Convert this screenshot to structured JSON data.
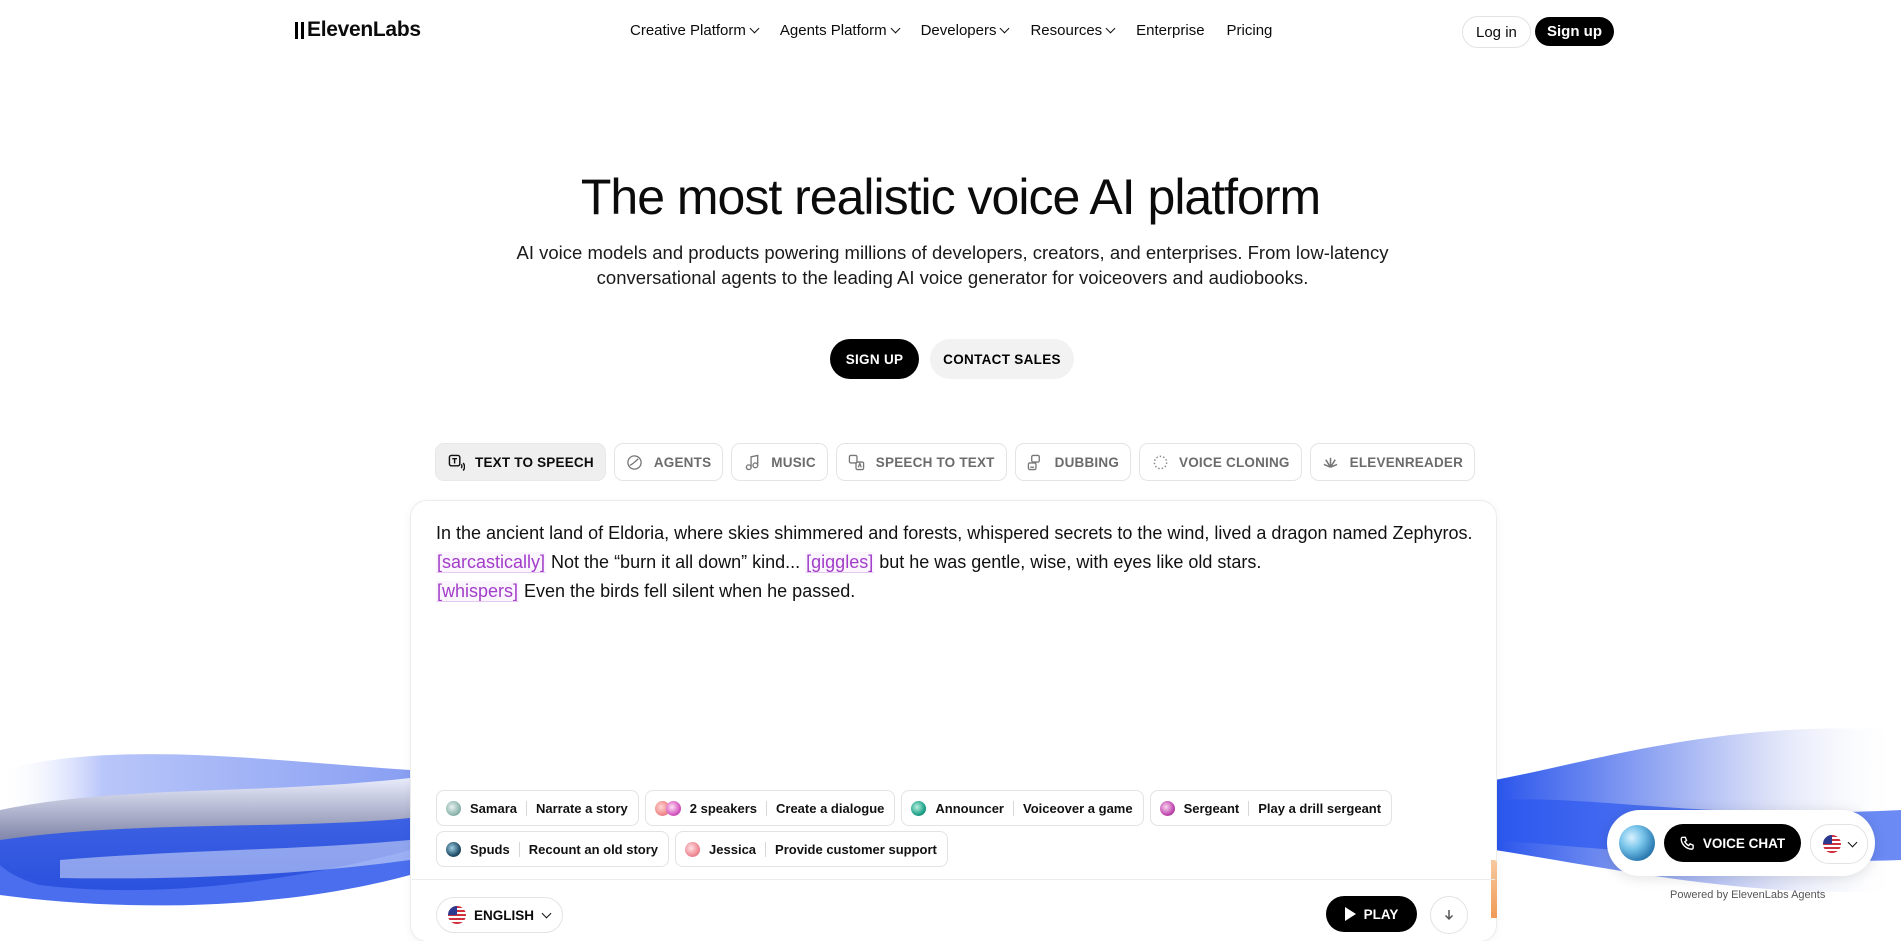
{
  "brand": {
    "logo_text": "ElevenLabs"
  },
  "nav": {
    "items": [
      {
        "label": "Creative Platform",
        "dropdown": true
      },
      {
        "label": "Agents Platform",
        "dropdown": true
      },
      {
        "label": "Developers",
        "dropdown": true
      },
      {
        "label": "Resources",
        "dropdown": true
      },
      {
        "label": "Enterprise",
        "dropdown": false
      },
      {
        "label": "Pricing",
        "dropdown": false
      }
    ],
    "login_label": "Log in",
    "signup_label": "Sign up"
  },
  "hero": {
    "title": "The most realistic voice AI platform",
    "subtitle": "AI voice models and products powering millions of developers, creators, and enterprises. From low-latency conversational agents to the leading AI voice generator for voiceovers and audiobooks.",
    "cta_primary": "SIGN UP",
    "cta_secondary": "CONTACT SALES"
  },
  "tabs": [
    {
      "label": "TEXT TO SPEECH",
      "icon": "text-to-speech-icon",
      "active": true
    },
    {
      "label": "AGENTS",
      "icon": "agents-icon",
      "active": false
    },
    {
      "label": "MUSIC",
      "icon": "music-icon",
      "active": false
    },
    {
      "label": "SPEECH TO TEXT",
      "icon": "speech-to-text-icon",
      "active": false
    },
    {
      "label": "DUBBING",
      "icon": "dubbing-icon",
      "active": false
    },
    {
      "label": "VOICE CLONING",
      "icon": "voice-cloning-icon",
      "active": false
    },
    {
      "label": "ELEVENREADER",
      "icon": "elevenreader-icon",
      "active": false
    }
  ],
  "editor": {
    "segments": [
      {
        "text": "In the ancient land of Eldoria, where skies shimmered and forests, whispered secrets to the wind, lived a dragon named Zephyros. ",
        "tag": false
      },
      {
        "text": "[sarcastically]",
        "tag": true
      },
      {
        "text": " Not the “burn it all down” kind... ",
        "tag": false
      },
      {
        "text": "[giggles]",
        "tag": true
      },
      {
        "text": " but he was gentle, wise, with eyes like old stars. ",
        "tag": false
      },
      {
        "text": "[whispers]",
        "tag": true
      },
      {
        "text": " Even the birds fell silent when he passed.",
        "tag": false
      }
    ],
    "presets": [
      [
        {
          "name": "Samara",
          "task": "Narrate a story",
          "color": "#8fb7b0"
        },
        {
          "name": "2 speakers",
          "task": "Create a dialogue",
          "color": "#f08a8a"
        },
        {
          "name": "Announcer",
          "task": "Voiceover a game",
          "color": "#1fa38a"
        },
        {
          "name": "Sergeant",
          "task": "Play a drill sergeant",
          "color": "#c24bb0"
        }
      ],
      [
        {
          "name": "Spuds",
          "task": "Recount an old story",
          "color": "#24506a"
        },
        {
          "name": "Jessica",
          "task": "Provide customer support",
          "color": "#ef8a94"
        }
      ]
    ],
    "language": "ENGLISH",
    "play_label": "PLAY"
  },
  "widget": {
    "voice_chat_label": "VOICE CHAT",
    "powered_by": "Powered by ElevenLabs Agents"
  },
  "colors": {
    "accent_tag": "#a23dc9",
    "wave_blue": "#2e5ff0",
    "button_black": "#000000"
  }
}
